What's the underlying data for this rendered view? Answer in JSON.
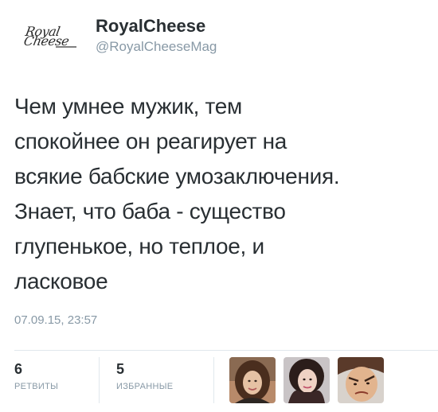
{
  "tweet": {
    "author": {
      "avatar_logo_line1": "Royal",
      "avatar_logo_line2": "Cheese",
      "display_name": "RoyalCheese",
      "screen_name": "@RoyalCheeseMag"
    },
    "text": "Чем умнее мужик, тем\nспокойнее он реагирует на\nвсякие бабские умозаключения.\nЗнает, что баба - существо\nглупенькое, но теплое, и\nласковое",
    "timestamp": "07.09.15, 23:57",
    "stats": {
      "retweets": {
        "count": "6",
        "label": "РЕТВИТЫ"
      },
      "favorites": {
        "count": "5",
        "label": "ИЗБРАННЫЕ"
      }
    },
    "favoriters": [
      {
        "icon": "user-avatar"
      },
      {
        "icon": "user-avatar"
      },
      {
        "icon": "user-avatar"
      }
    ]
  },
  "colors": {
    "text_primary": "#292f33",
    "text_secondary": "#8899a6",
    "divider": "#e1e8ed",
    "background": "#ffffff"
  }
}
